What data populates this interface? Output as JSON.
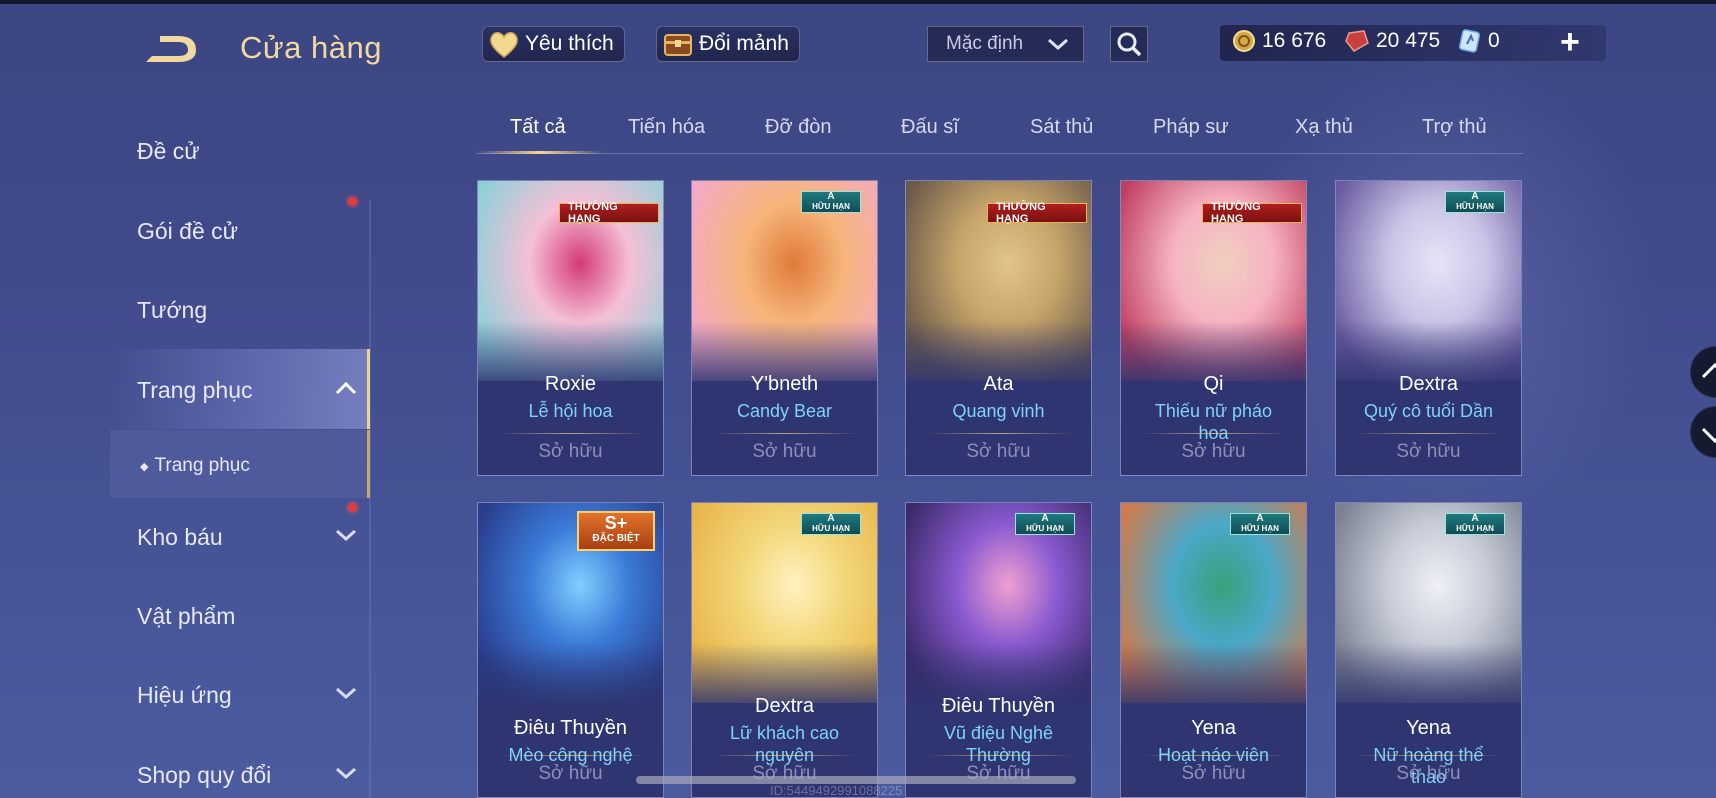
{
  "header": {
    "title": "Cửa hàng",
    "favorites_label": "Yêu thích",
    "exchange_label": "Đổi mảnh",
    "sort_value": "Mặc định",
    "currencies": [
      {
        "icon": "gold-coin-icon",
        "value": "16 676"
      },
      {
        "icon": "ruby-gem-icon",
        "value": "20 475"
      },
      {
        "icon": "voucher-card-icon",
        "value": "0"
      }
    ]
  },
  "sidebar": {
    "items": [
      {
        "label": "Đề cử"
      },
      {
        "label": "Gói đề cử"
      },
      {
        "label": "Tướng"
      },
      {
        "label": "Trang phục"
      },
      {
        "label": "Trang phục"
      },
      {
        "label": "Kho báu"
      },
      {
        "label": "Vật phẩm"
      },
      {
        "label": "Hiệu ứng"
      },
      {
        "label": "Shop quy đổi"
      }
    ]
  },
  "tabs": [
    "Tất cả",
    "Tiến hóa",
    "Đỡ đòn",
    "Đấu sĩ",
    "Sát thủ",
    "Pháp sư",
    "Xạ thủ",
    "Trợ thủ"
  ],
  "cards": [
    {
      "hero": "Roxie",
      "skin": "Lễ hội hoa",
      "status": "Sở hữu",
      "tag": "THƯỜNG HẠNG"
    },
    {
      "hero": "Y'bneth",
      "skin": "Candy Bear",
      "status": "Sở hữu",
      "tag": "A HỮU HẠN"
    },
    {
      "hero": "Ata",
      "skin": "Quang vinh",
      "status": "Sở hữu",
      "tag": "THƯỜNG HẠNG"
    },
    {
      "hero": "Qi",
      "skin": "Thiếu nữ pháo hoa",
      "status": "Sở hữu",
      "tag": "THƯỜNG HẠNG"
    },
    {
      "hero": "Dextra",
      "skin": "Quý cô tuổi Dần",
      "status": "Sở hữu",
      "tag": "A HỮU HẠN"
    },
    {
      "hero": "Điêu Thuyền",
      "skin": "Mèo công nghệ",
      "status": "Sở hữu",
      "tag": "S+ ĐẶC BIỆT"
    },
    {
      "hero": "Dextra",
      "skin": "Lữ khách cao nguyên",
      "status": "Sở hữu",
      "tag": "A HỮU HẠN"
    },
    {
      "hero": "Điêu Thuyền",
      "skin": "Vũ điệu Nghê Thường",
      "status": "Sở hữu",
      "tag": "A HỮU HẠN"
    },
    {
      "hero": "Yena",
      "skin": "Hoạt náo viên",
      "status": "Sở hữu",
      "tag": "A HỮU HẠN"
    },
    {
      "hero": "Yena",
      "skin": "Nữ hoàng thể thao",
      "status": "Sở hữu",
      "tag": "A HỮU HẠN"
    }
  ],
  "tag_labels": {
    "rank": "THƯỜNG HẠNG",
    "a": "A",
    "limited": "HỮU HẠN",
    "sp": "S+",
    "special": "ĐẶC BIỆT"
  },
  "watermark": "ID:5449492991088225"
}
